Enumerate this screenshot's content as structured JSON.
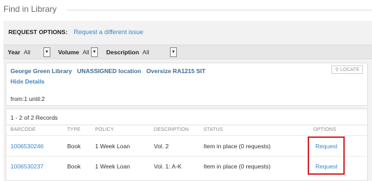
{
  "header": {
    "title": "Find in Library"
  },
  "request_options": {
    "label": "REQUEST OPTIONS:",
    "link": "Request a different issue"
  },
  "filters": [
    {
      "label": "Year",
      "value": "All"
    },
    {
      "label": "Volume",
      "value": "All"
    },
    {
      "label": "Description",
      "value": "All"
    }
  ],
  "location": {
    "library": "George Green Library",
    "location": "UNASSIGNED location",
    "call_number": "Oversize RA1215 SIT",
    "locate_label": "LOCATE",
    "hide_details": "Hide Details",
    "range": "from:1 until:2"
  },
  "records": {
    "count_text": "1 - 2 of 2 Records",
    "columns": [
      "BARCODE",
      "TYPE",
      "POLICY",
      "DESCRIPTION",
      "STATUS",
      "OPTIONS"
    ],
    "rows": [
      {
        "barcode": "1006530246",
        "type": "Book",
        "policy": "1 Week Loan",
        "description": "Vol. 2",
        "status": "Item in place (0 requests)",
        "option": "Request"
      },
      {
        "barcode": "1006530237",
        "type": "Book",
        "policy": "1 Week Loan",
        "description": "Vol. 1: A-K",
        "status": "Item in place (0 requests)",
        "option": "Request"
      }
    ]
  },
  "colors": {
    "link": "#3d86c6",
    "highlight_box": "#d9202a",
    "panel_bg": "#f2f2f2"
  }
}
